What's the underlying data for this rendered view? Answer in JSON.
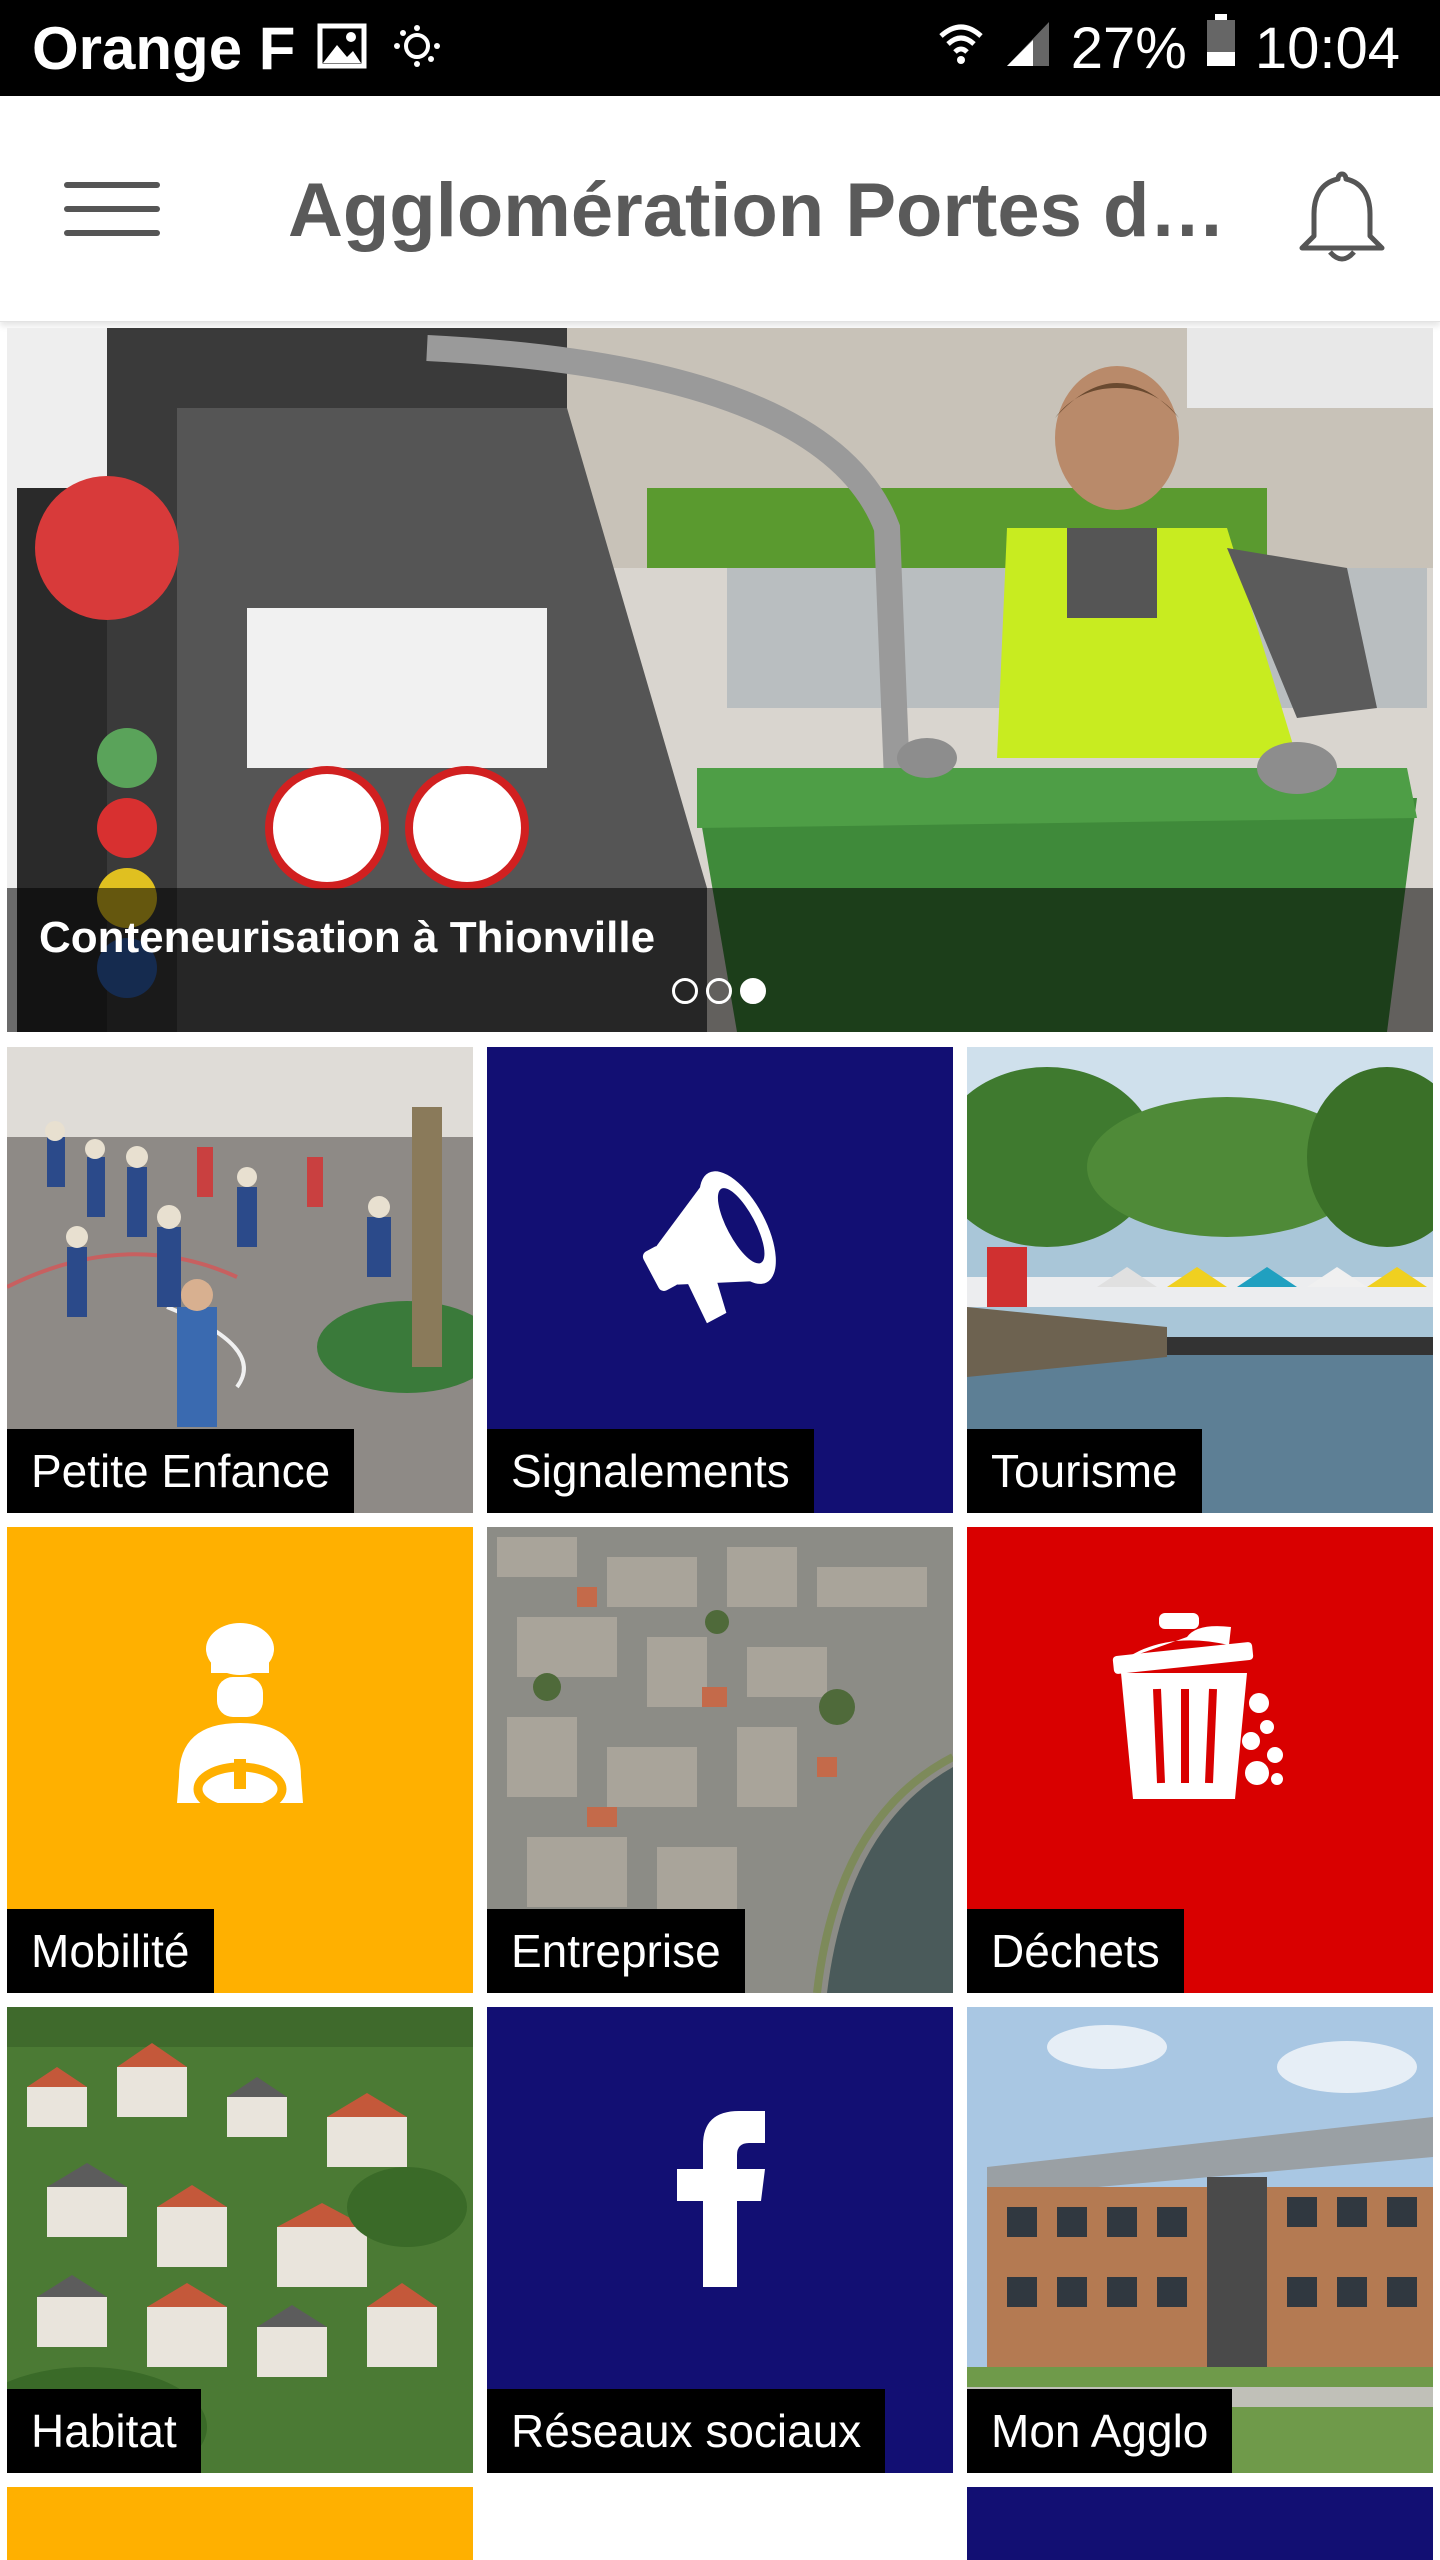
{
  "status_bar": {
    "carrier": "Orange F",
    "battery_percent": "27%",
    "time": "10:04",
    "icons": [
      "image-icon",
      "sync-icon",
      "wifi-icon",
      "signal-icon",
      "battery-icon"
    ]
  },
  "app_bar": {
    "title": "Agglomération Portes d…",
    "menu_icon": "hamburger-menu-icon",
    "notification_icon": "bell-icon"
  },
  "hero": {
    "caption": "Conteneurisation à Thionville",
    "slide_count": 3,
    "active_slide": 3
  },
  "tiles": [
    {
      "label": "Petite Enfance",
      "kind": "photo",
      "photo": "children-schoolyard"
    },
    {
      "label": "Signalements",
      "kind": "icon",
      "icon": "megaphone-icon",
      "color": "#120f73"
    },
    {
      "label": "Tourisme",
      "kind": "photo",
      "photo": "lake-festival"
    },
    {
      "label": "Mobilité",
      "kind": "icon",
      "icon": "driver-icon",
      "color": "#ffb000"
    },
    {
      "label": "Entreprise",
      "kind": "photo",
      "photo": "aerial-city"
    },
    {
      "label": "Déchets",
      "kind": "icon",
      "icon": "trash-can-icon",
      "color": "#d90000"
    },
    {
      "label": "Habitat",
      "kind": "photo",
      "photo": "hillside-houses"
    },
    {
      "label": "Réseaux sociaux",
      "kind": "icon",
      "icon": "facebook-icon",
      "color": "#120f73"
    },
    {
      "label": "Mon Agglo",
      "kind": "photo",
      "photo": "office-building"
    }
  ],
  "colors": {
    "navy": "#120f73",
    "yellow": "#ffb000",
    "red": "#d90000",
    "title_gray": "#5a5a5a"
  }
}
